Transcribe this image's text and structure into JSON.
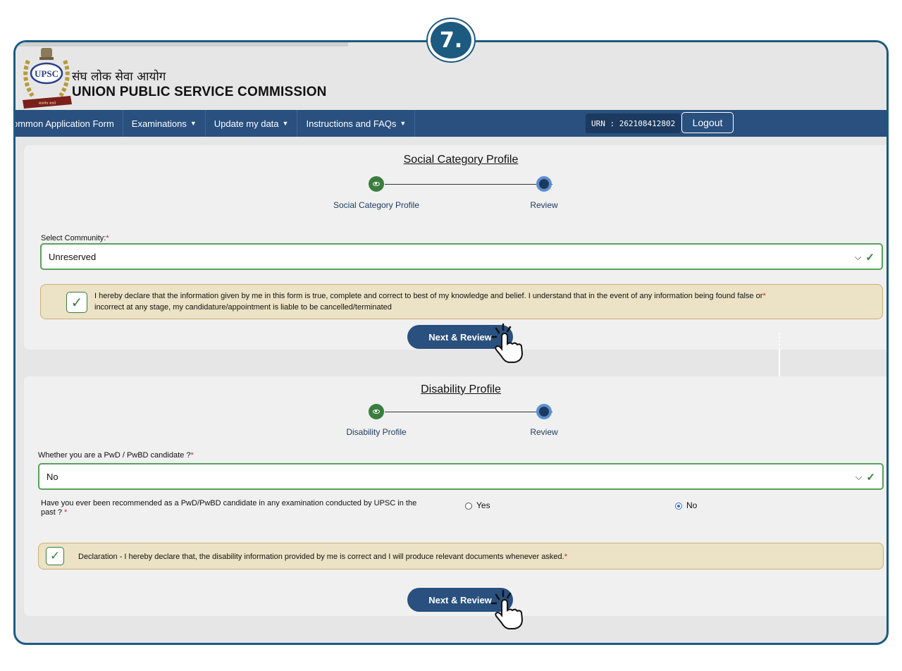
{
  "step_badge": "7.",
  "header": {
    "emblem_text": "UPSC",
    "hindi_name": "संघ लोक सेवा आयोग",
    "english_name": "UNION PUBLIC SERVICE COMMISSION"
  },
  "nav": {
    "items": [
      {
        "label": "ommon Application Form",
        "caret": false
      },
      {
        "label": "Examinations",
        "caret": true
      },
      {
        "label": "Update my data",
        "caret": true
      },
      {
        "label": "Instructions and FAQs",
        "caret": true
      }
    ],
    "urn": "URN : 262108412802",
    "logout": "Logout"
  },
  "social": {
    "title": "Social Category Profile",
    "step1": "Social Category Profile",
    "step2": "Review",
    "community_label": "Select Community:",
    "community_required": "*",
    "community_value": "Unreserved",
    "declaration_line1": "I hereby declare that the information given by me in this form is true, complete and correct to best of my knowledge and belief. I understand that in the event of any information being found false or",
    "declaration_line2": "incorrect at any stage, my candidature/appointment is liable to be cancelled/terminated",
    "declaration_required": "*",
    "next_label": "Next & Review"
  },
  "disability": {
    "title": "Disability Profile",
    "step1": "Disability Profile",
    "step2": "Review",
    "pwd_label": "Whether you are a PwD / PwBD candidate ?",
    "pwd_required": "*",
    "pwd_value": "No",
    "recommended_q_line1": "Have you ever been recommended as a PwD/PwBD candidate in any examination conducted by UPSC in the",
    "recommended_q_line2": "past ?",
    "recommended_required": "*",
    "option_yes": "Yes",
    "option_no": "No",
    "selected_option": "No",
    "declaration": "Declaration - I hereby declare that, the disability information provided by me is correct and I will produce relevant documents whenever asked.",
    "declaration_required": "*",
    "next_label": "Next & Review"
  },
  "colors": {
    "frame": "#1d5a80",
    "navbar": "#29507e",
    "button": "#29507e",
    "success_green": "#3a7d3e",
    "declaration_bg": "#ece2c5"
  }
}
